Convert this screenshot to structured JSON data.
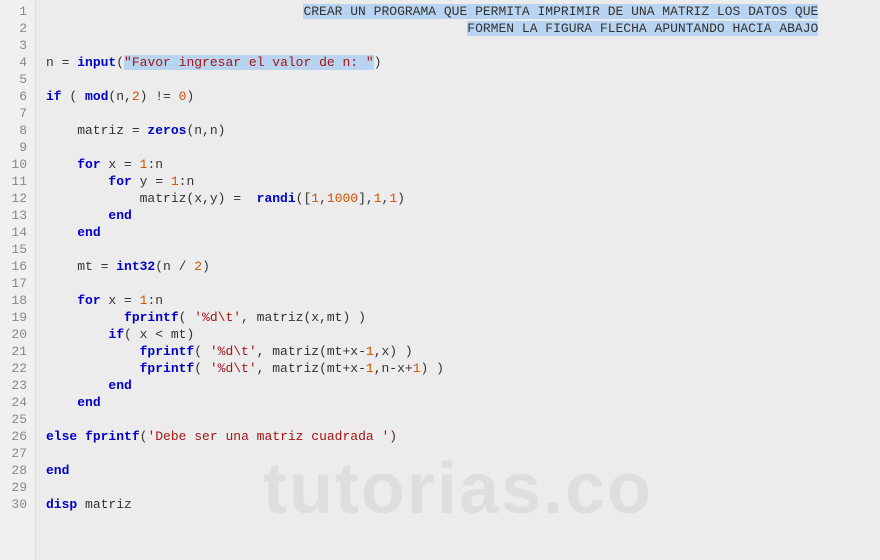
{
  "watermark": "tutorias.co",
  "gutter": {
    "lines": [
      "1",
      "2",
      "3",
      "4",
      "5",
      "6",
      "7",
      "8",
      "9",
      "10",
      "11",
      "12",
      "13",
      "14",
      "15",
      "16",
      "17",
      "18",
      "19",
      "20",
      "21",
      "22",
      "23",
      "24",
      "25",
      "26",
      "27",
      "28",
      "29",
      "30"
    ]
  },
  "code": {
    "comment1": "CREAR UN PROGRAMA QUE PERMITA IMPRIMIR DE UNA MATRIZ LOS DATOS QUE",
    "comment2": "FORMEN LA FIGURA FLECHA APUNTANDO HACIA ABAJO",
    "l4_pre": "n = ",
    "l4_fn": "input",
    "l4_p1": "(",
    "l4_str": "\"Favor ingresar el valor de n: \"",
    "l4_p2": ")",
    "l6_if": "if",
    "l6_body": " ( ",
    "l6_mod": "mod",
    "l6_args": "(n,",
    "l6_n2": "2",
    "l6_args2": ") != ",
    "l6_zero": "0",
    "l6_close": ")",
    "l8_pre": "    matriz = ",
    "l8_fn": "zeros",
    "l8_args": "(n,n)",
    "l10_for": "for",
    "l10_body": " x = ",
    "l10_one": "1",
    "l10_rest": ":n",
    "l11_for": "for",
    "l11_body": " y = ",
    "l11_one": "1",
    "l11_rest": ":n",
    "l12_pre": "            matriz(x,y) =  ",
    "l12_fn": "randi",
    "l12_p1": "([",
    "l12_n1": "1",
    "l12_c": ",",
    "l12_n2": "1000",
    "l12_p2": "],",
    "l12_n3": "1",
    "l12_c2": ",",
    "l12_n4": "1",
    "l12_p3": ")",
    "l13_end": "end",
    "l14_end": "end",
    "l16_pre": "    mt = ",
    "l16_fn": "int32",
    "l16_p1": "(n / ",
    "l16_n": "2",
    "l16_p2": ")",
    "l18_for": "for",
    "l18_body": " x = ",
    "l18_one": "1",
    "l18_rest": ":n",
    "l19_fn": "fprintf",
    "l19_p1": "( ",
    "l19_str": "'%d\\t'",
    "l19_p2": ", matriz(x,mt) )",
    "l20_if": "if",
    "l20_body": "( x < mt)",
    "l21_fn": "fprintf",
    "l21_p1": "( ",
    "l21_str": "'%d\\t'",
    "l21_p2": ", matriz(mt+x-",
    "l21_n": "1",
    "l21_p3": ",x) )",
    "l22_fn": "fprintf",
    "l22_p1": "( ",
    "l22_str": "'%d\\t'",
    "l22_p2": ", matriz(mt+x-",
    "l22_n": "1",
    "l22_p3": ",n-x+",
    "l22_n2": "1",
    "l22_p4": ") )",
    "l23_end": "end",
    "l24_end": "end",
    "l26_else": "else",
    "l26_fn": "fprintf",
    "l26_p1": "(",
    "l26_str": "'Debe ser una matriz cuadrada '",
    "l26_p2": ")",
    "l28_end": "end",
    "l30_disp": "disp",
    "l30_body": " matriz"
  }
}
